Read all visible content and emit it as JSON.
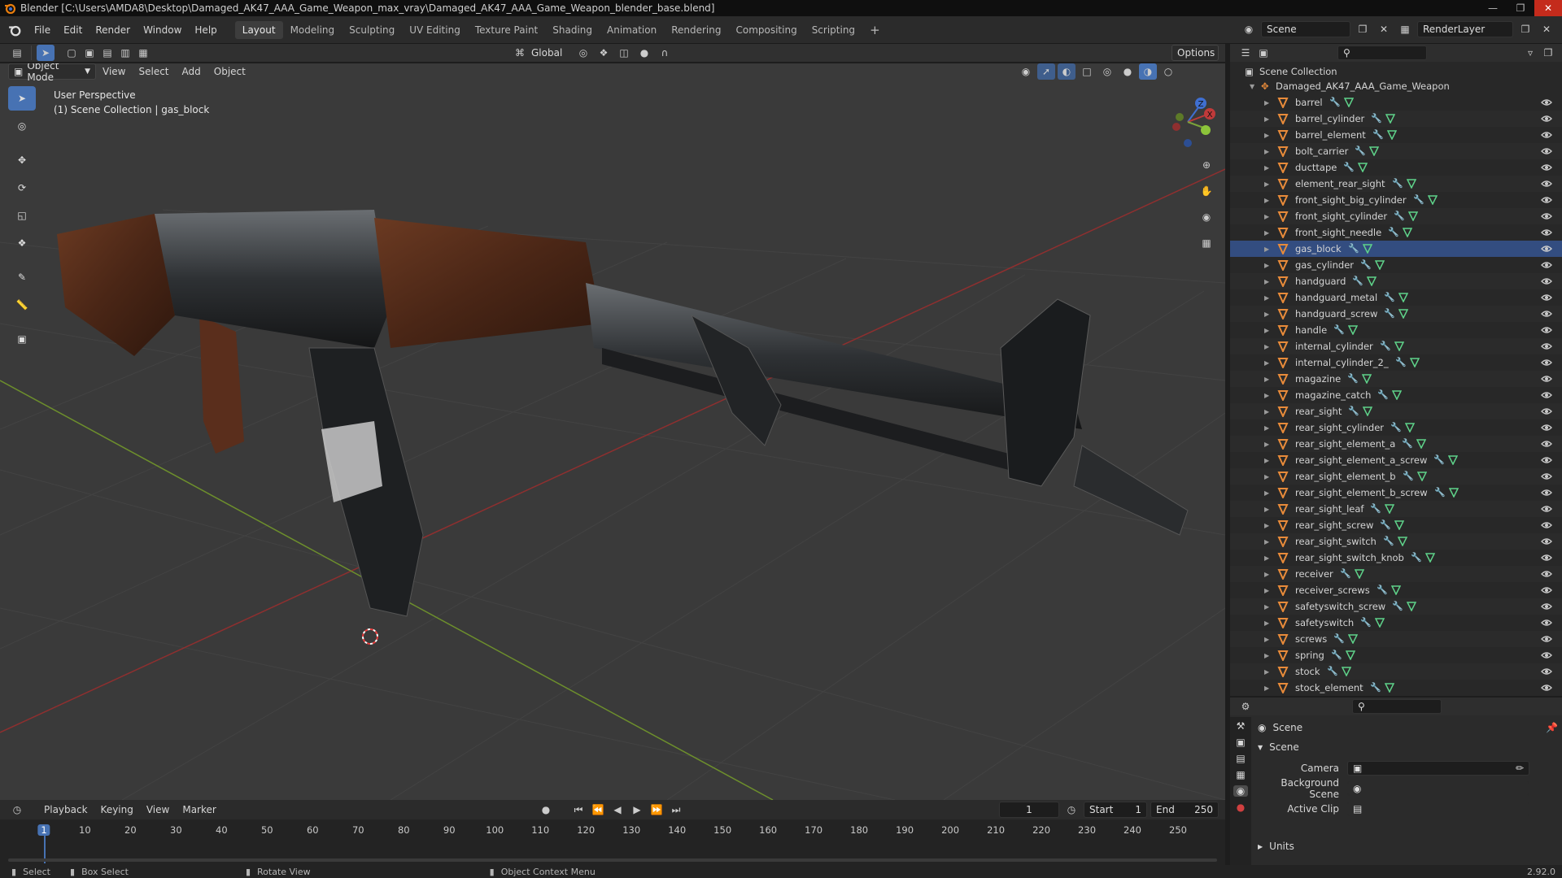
{
  "titlebar": {
    "title": "Blender [C:\\Users\\AMDA8\\Desktop\\Damaged_AK47_AAA_Game_Weapon_max_vray\\Damaged_AK47_AAA_Game_Weapon_blender_base.blend]"
  },
  "menu": [
    "File",
    "Edit",
    "Render",
    "Window",
    "Help"
  ],
  "workspaces": [
    "Layout",
    "Modeling",
    "Sculpting",
    "UV Editing",
    "Texture Paint",
    "Shading",
    "Animation",
    "Rendering",
    "Compositing",
    "Scripting"
  ],
  "active_workspace": "Layout",
  "scene_name": "Scene",
  "view_layer": "RenderLayer",
  "viewport": {
    "mode": "Object Mode",
    "menus": [
      "View",
      "Select",
      "Add",
      "Object"
    ],
    "transform_orientation": "Global",
    "options_label": "Options",
    "overlay_line1": "User Perspective",
    "overlay_line2": "(1) Scene Collection | gas_block",
    "gizmo_axes": [
      "X",
      "Y",
      "Z"
    ]
  },
  "outliner": {
    "root": "Scene Collection",
    "collection": "Damaged_AK47_AAA_Game_Weapon",
    "objects": [
      "barrel",
      "barrel_cylinder",
      "barrel_element",
      "bolt_carrier",
      "ducttape",
      "element_rear_sight",
      "front_sight_big_cylinder",
      "front_sight_cylinder",
      "front_sight_needle",
      "gas_block",
      "gas_cylinder",
      "handguard",
      "handguard_metal",
      "handguard_screw",
      "handle",
      "internal_cylinder",
      "internal_cylinder_2_",
      "magazine",
      "magazine_catch",
      "rear_sight",
      "rear_sight_cylinder",
      "rear_sight_element_a",
      "rear_sight_element_a_screw",
      "rear_sight_element_b",
      "rear_sight_element_b_screw",
      "rear_sight_leaf",
      "rear_sight_screw",
      "rear_sight_switch",
      "rear_sight_switch_knob",
      "receiver",
      "receiver_screws",
      "safetyswitch_screw",
      "safetyswitch",
      "screws",
      "spring",
      "stock",
      "stock_element"
    ],
    "active_object": "gas_block"
  },
  "properties": {
    "context": "Scene",
    "panel": "Scene",
    "fields": [
      {
        "label": "Camera",
        "value": ""
      },
      {
        "label": "Background Scene",
        "value": ""
      },
      {
        "label": "Active Clip",
        "value": ""
      }
    ],
    "units_panel": "Units",
    "version": "2.92.0"
  },
  "timeline": {
    "menus": [
      "Playback",
      "Keying",
      "View",
      "Marker"
    ],
    "current_frame": "1",
    "start_label": "Start",
    "start": "1",
    "end_label": "End",
    "end": "250",
    "ticks": [
      "1",
      "10",
      "20",
      "30",
      "40",
      "50",
      "60",
      "70",
      "80",
      "90",
      "100",
      "110",
      "120",
      "130",
      "140",
      "150",
      "160",
      "170",
      "180",
      "190",
      "200",
      "210",
      "220",
      "230",
      "240",
      "250"
    ]
  },
  "statusbar": {
    "items": [
      "Select",
      "Box Select",
      "Rotate View",
      "Object Context Menu"
    ]
  },
  "colors": {
    "accent": "#4772b3",
    "object_orange": "#e88b3a",
    "mesh_green": "#5fd38a",
    "x_axis": "#c03a3a",
    "y_axis": "#7aa33a",
    "z_axis": "#3f6fd1"
  }
}
